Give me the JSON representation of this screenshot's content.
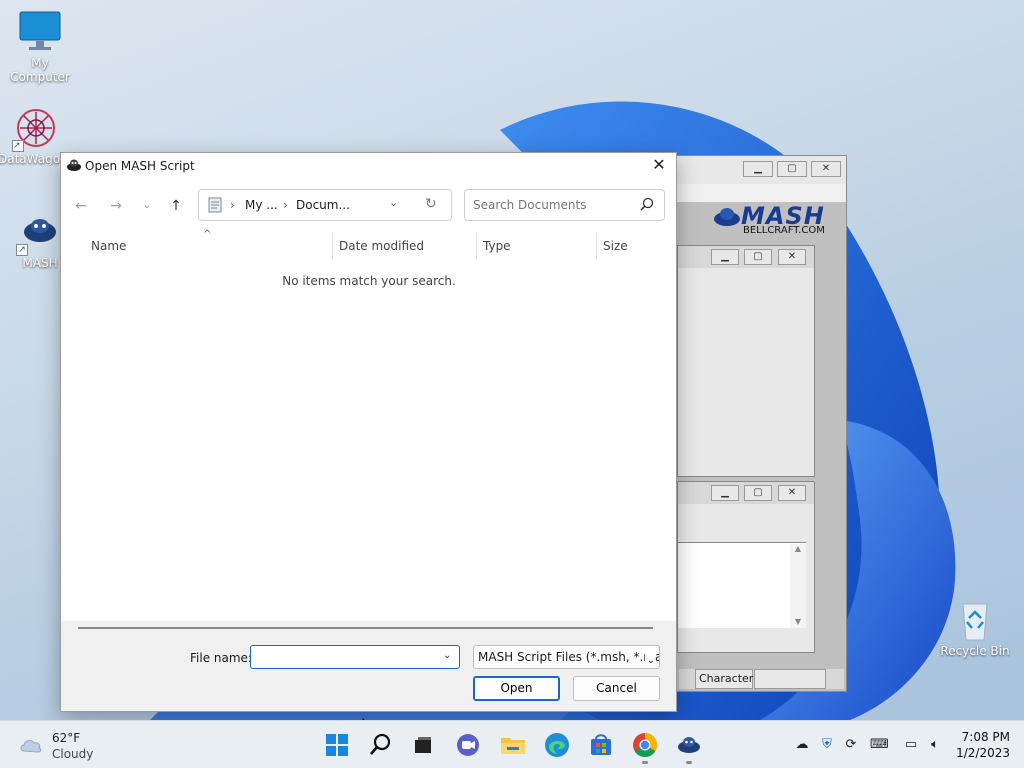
{
  "desktop": {
    "icons": [
      {
        "label": "My Computer",
        "icon": "monitor-icon"
      },
      {
        "label": "DataWago",
        "icon": "datawagon-icon"
      },
      {
        "label": "MASH",
        "icon": "mash-icon"
      },
      {
        "label": "Recycle Bin",
        "icon": "recycle-bin-icon"
      }
    ]
  },
  "mash_app": {
    "logo_text": "MASH",
    "logo_site": "BELLCRAFT.COM",
    "status_character_label": "Character:"
  },
  "dialog": {
    "title": "Open MASH Script",
    "breadcrumb": [
      "My ...",
      "Docum..."
    ],
    "search_placeholder": "Search Documents",
    "columns": [
      "Name",
      "Date modified",
      "Type",
      "Size"
    ],
    "empty_message": "No items match your search.",
    "file_name_label": "File name:",
    "file_name_value": "",
    "file_type_selected": "MASH Script Files (*.msh, *.mas",
    "open_label": "Open",
    "cancel_label": "Cancel"
  },
  "taskbar": {
    "weather_temp": "62°F",
    "weather_desc": "Cloudy",
    "time": "7:08 PM",
    "date": "1/2/2023"
  },
  "colors": {
    "accent": "#1a66c4",
    "bloom": "#1f5fd8"
  }
}
